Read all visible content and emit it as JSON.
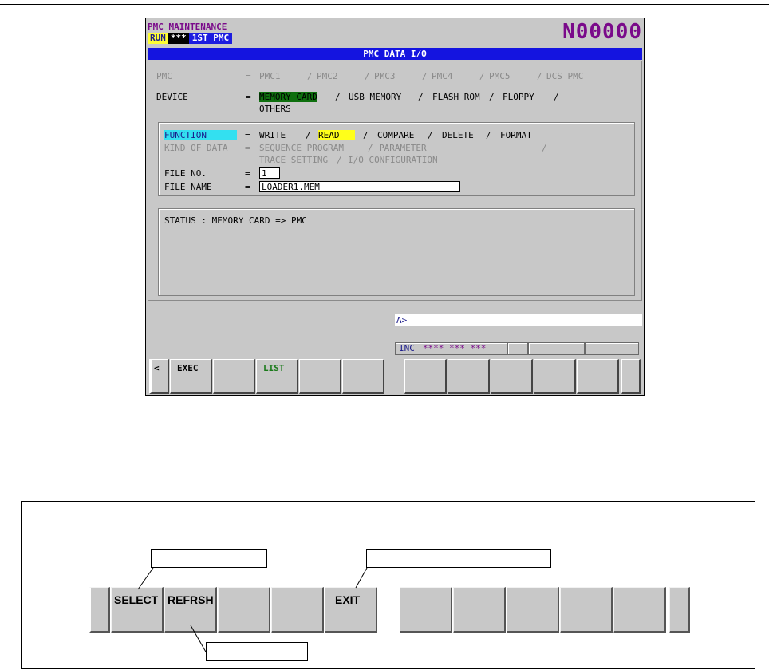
{
  "header": {
    "mode_title": "PMC MAINTENANCE",
    "run_status": "RUN",
    "alarm_status": "***",
    "pmc_name": "1ST PMC",
    "sequence_number": "N00000"
  },
  "screen_title": "PMC DATA I/O",
  "pmc_row": {
    "label": "PMC",
    "options": [
      "PMC1",
      "PMC2",
      "PMC3",
      "PMC4",
      "PMC5",
      "DCS PMC"
    ]
  },
  "device_row": {
    "label": "DEVICE",
    "options": [
      "MEMORY CARD",
      "USB MEMORY",
      "FLASH ROM",
      "FLOPPY",
      "OTHERS"
    ],
    "selected": "MEMORY CARD"
  },
  "function_row": {
    "label": "FUNCTION",
    "options": [
      "WRITE",
      "READ",
      "COMPARE",
      "DELETE",
      "FORMAT"
    ],
    "selected": "READ"
  },
  "kind_of_data_row": {
    "label": "KIND OF DATA",
    "options": [
      "SEQUENCE PROGRAM",
      "PARAMETER",
      "TRACE SETTING",
      "I/O CONFIGURATION"
    ]
  },
  "file_no": {
    "label": "FILE NO.",
    "value": "1"
  },
  "file_name": {
    "label": "FILE NAME",
    "value": "LOADER1.MEM"
  },
  "status_message": "STATUS : MEMORY CARD => PMC",
  "input_line": "A>_",
  "status_bar": {
    "mode": "INC",
    "indicators": "**** *** ***"
  },
  "softkeys": [
    "<",
    "EXEC",
    "",
    "LIST",
    "",
    "",
    "",
    "",
    "",
    "",
    "",
    ""
  ],
  "softkeys_figure": {
    "keys": [
      "SELECT",
      "REFRSH",
      "",
      "",
      "EXIT",
      "",
      "",
      "",
      "",
      "",
      ""
    ]
  },
  "colors": {
    "title_bar": "#1414e0",
    "screen_bg": "#c8c8c8",
    "selection_green": "#0e6f0e",
    "selection_yellow": "#ffff1a",
    "focus_cyan": "#33e0f0",
    "header_purple": "#7a0a8a"
  }
}
